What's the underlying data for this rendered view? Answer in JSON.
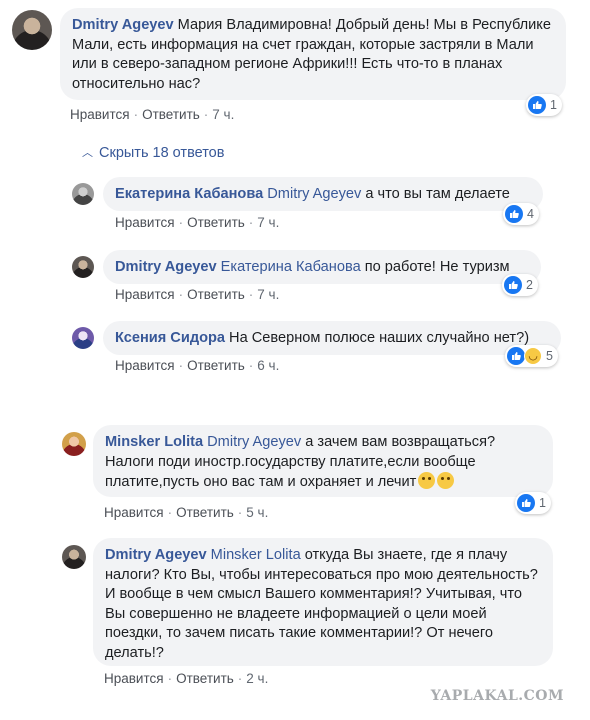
{
  "comments": [
    {
      "author": "Dmitry Ageyev",
      "mention": "",
      "text": "Мария Владимировна! Добрый день! Мы в Республике Мали, есть информация на счет граждан, которые застряли в Мали или в северо-западном регионе Африки!!! Есть что-то в планах относительно нас?",
      "like_label": "Нравится",
      "reply_label": "Ответить",
      "time": "7 ч.",
      "reaction_count": "1"
    }
  ],
  "hide_replies_label": "Скрыть 18 ответов",
  "replies": [
    {
      "author": "Екатерина Кабанова",
      "mention": "Dmitry Ageyev",
      "text": "а что вы там делаете",
      "like_label": "Нравится",
      "reply_label": "Ответить",
      "time": "7 ч.",
      "reaction_count": "4"
    },
    {
      "author": "Dmitry Ageyev",
      "mention": "Екатерина Кабанова",
      "text": "по работе! Не туризм",
      "like_label": "Нравится",
      "reply_label": "Ответить",
      "time": "7 ч.",
      "reaction_count": "2"
    },
    {
      "author": "Ксения Сидора",
      "mention": "",
      "text": "На Северном полюсе наших случайно нет?)",
      "like_label": "Нравится",
      "reply_label": "Ответить",
      "time": "6 ч.",
      "reaction_count": "5"
    },
    {
      "author": "Minsker Lolita",
      "mention": "Dmitry Ageyev",
      "text": "а зачем вам возвращаться? Налоги поди иностр.государству платите,если вообще платите,пусть оно вас там и охраняет и лечит",
      "like_label": "Нравится",
      "reply_label": "Ответить",
      "time": "5 ч.",
      "reaction_count": "1"
    },
    {
      "author": "Dmitry Ageyev",
      "mention": "Minsker Lolita",
      "text": "откуда Вы знаете, где я плачу налоги? Кто Вы, чтобы интересоваться про мою деятельность? И вообще в чем смысл Вашего комментария!? Учитывая, что Вы совершенно не владеете информацией о цели моей поездки, то зачем писать такие комментарии!? От нечего делать!?",
      "like_label": "Нравится",
      "reply_label": "Ответить",
      "time": "2 ч."
    }
  ],
  "watermark": "YAPLAKAL.COM",
  "icons": {
    "like": "like-icon",
    "haha": "haha-icon",
    "chevron": "chevron-up-icon"
  },
  "colors": {
    "link": "#385898",
    "bubble": "#f2f3f5",
    "like": "#1877f2"
  }
}
